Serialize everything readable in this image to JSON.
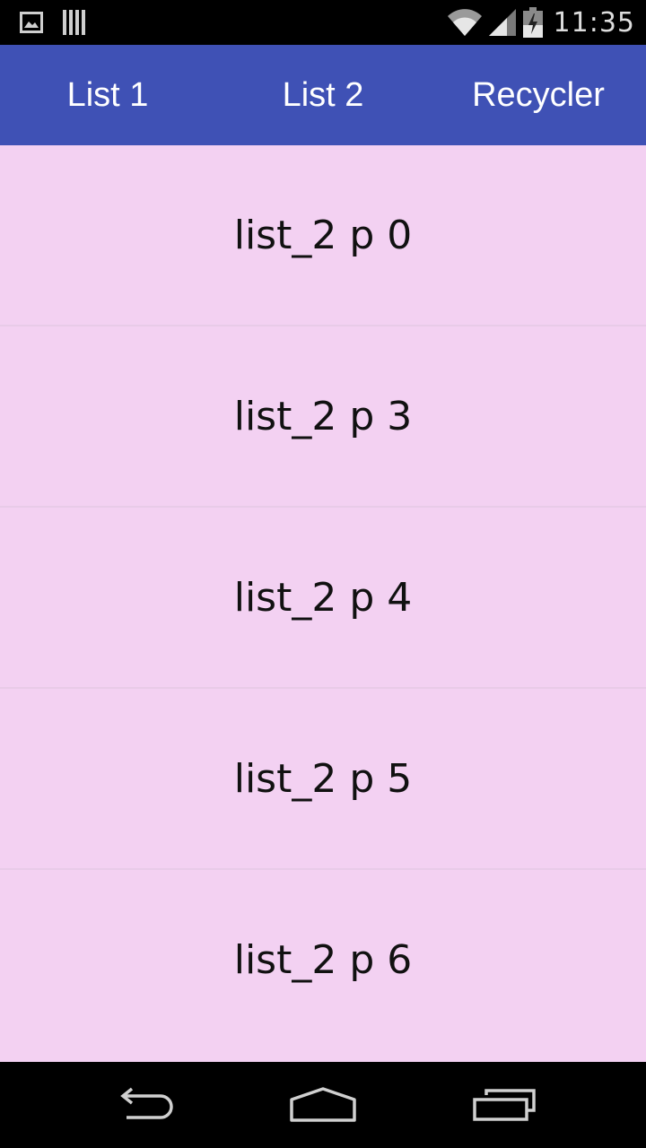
{
  "status_bar": {
    "time": "11:35",
    "icons": [
      "gallery-notification-icon",
      "barcode-notification-icon",
      "wifi-icon",
      "cell-signal-icon",
      "battery-charging-icon"
    ]
  },
  "tabs": [
    {
      "label": "List 1"
    },
    {
      "label": "List 2"
    },
    {
      "label": "Recycler"
    }
  ],
  "list": {
    "items": [
      {
        "label": "list_2 p 0"
      },
      {
        "label": "list_2 p 3"
      },
      {
        "label": "list_2 p 4"
      },
      {
        "label": "list_2 p 5"
      },
      {
        "label": "list_2 p 6"
      }
    ]
  },
  "nav_bar": {
    "icons": [
      "back-icon",
      "home-icon",
      "recent-apps-icon"
    ]
  },
  "colors": {
    "app_bar": "#3f51b5",
    "list_background": "#f3d1f2",
    "divider": "#e8cbe8"
  }
}
